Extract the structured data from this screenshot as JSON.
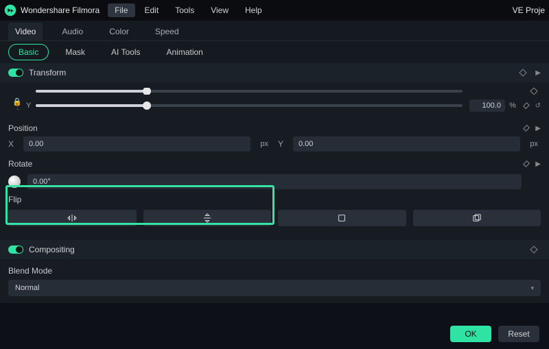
{
  "app": {
    "title": "Wondershare Filmora",
    "project_label": "VE Proje"
  },
  "menu": {
    "file": "File",
    "edit": "Edit",
    "tools": "Tools",
    "view": "View",
    "help": "Help"
  },
  "tabs": {
    "video": "Video",
    "audio": "Audio",
    "color": "Color",
    "speed": "Speed"
  },
  "subtabs": {
    "basic": "Basic",
    "mask": "Mask",
    "ai_tools": "AI Tools",
    "animation": "Animation"
  },
  "transform": {
    "title": "Transform",
    "scale_y_label": "Y",
    "scale_y_value": "100.0",
    "scale_y_unit": "%",
    "position_label": "Position",
    "position_x_label": "X",
    "position_x_value": "0.00",
    "position_x_unit": "px",
    "position_y_label": "Y",
    "position_y_value": "0.00",
    "position_y_unit": "px",
    "rotate_label": "Rotate",
    "rotate_value": "0.00°",
    "flip_label": "Flip"
  },
  "compositing": {
    "title": "Compositing"
  },
  "blend": {
    "label": "Blend Mode",
    "value": "Normal"
  },
  "footer": {
    "ok": "OK",
    "reset": "Reset"
  }
}
